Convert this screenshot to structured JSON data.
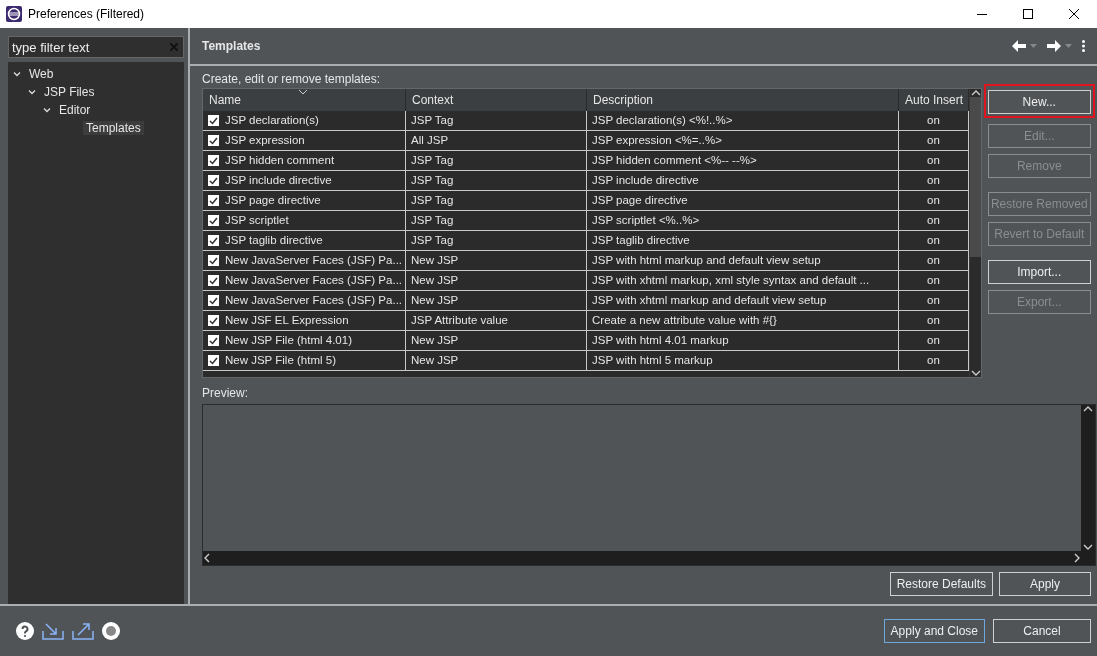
{
  "window": {
    "title": "Preferences (Filtered)"
  },
  "filter": {
    "placeholder": "type filter text"
  },
  "tree": [
    {
      "label": "Web",
      "expanded": true,
      "selected": false,
      "children": [
        {
          "label": "JSP Files",
          "expanded": true,
          "selected": false,
          "children": [
            {
              "label": "Editor",
              "expanded": true,
              "selected": false,
              "children": [
                {
                  "label": "Templates",
                  "selected": true
                }
              ]
            }
          ]
        }
      ]
    }
  ],
  "page": {
    "title": "Templates",
    "intro": "Create, edit or remove templates:"
  },
  "table": {
    "columns": [
      "Name",
      "Context",
      "Description",
      "Auto Insert"
    ],
    "rows": [
      {
        "checked": true,
        "name": "JSP declaration(s)",
        "context": "JSP Tag",
        "description": "JSP declaration(s) <%!..%>",
        "auto_insert": "on"
      },
      {
        "checked": true,
        "name": "JSP expression",
        "context": "All JSP",
        "description": "JSP expression <%=..%>",
        "auto_insert": "on"
      },
      {
        "checked": true,
        "name": "JSP hidden comment",
        "context": "JSP Tag",
        "description": "JSP hidden comment <%-- --%>",
        "auto_insert": "on"
      },
      {
        "checked": true,
        "name": "JSP include directive",
        "context": "JSP Tag",
        "description": "JSP include directive",
        "auto_insert": "on"
      },
      {
        "checked": true,
        "name": "JSP page directive",
        "context": "JSP Tag",
        "description": "JSP page directive",
        "auto_insert": "on"
      },
      {
        "checked": true,
        "name": "JSP scriptlet",
        "context": "JSP Tag",
        "description": "JSP scriptlet <%..%>",
        "auto_insert": "on"
      },
      {
        "checked": true,
        "name": "JSP taglib directive",
        "context": "JSP Tag",
        "description": "JSP taglib directive",
        "auto_insert": "on"
      },
      {
        "checked": true,
        "name": "New JavaServer Faces (JSF) Pa...",
        "context": "New JSP",
        "description": "JSP with html markup and default view setup",
        "auto_insert": "on"
      },
      {
        "checked": true,
        "name": "New JavaServer Faces (JSF) Pa...",
        "context": "New JSP",
        "description": "JSP with xhtml markup, xml style syntax and default ...",
        "auto_insert": "on"
      },
      {
        "checked": true,
        "name": "New JavaServer Faces (JSF) Pa...",
        "context": "New JSP",
        "description": "JSP with xhtml markup and default view setup",
        "auto_insert": "on"
      },
      {
        "checked": true,
        "name": "New JSF EL Expression",
        "context": "JSP Attribute value",
        "description": "Create a new attribute value with #{}",
        "auto_insert": "on"
      },
      {
        "checked": true,
        "name": "New JSP File (html 4.01)",
        "context": "New JSP",
        "description": "JSP with html 4.01 markup",
        "auto_insert": "on"
      },
      {
        "checked": true,
        "name": "New JSP File (html 5)",
        "context": "New JSP",
        "description": "JSP with html 5 markup",
        "auto_insert": "on"
      }
    ]
  },
  "side_button_groups": [
    [
      {
        "label": "New...",
        "disabled": false,
        "highlighted": true
      },
      {
        "label": "Edit...",
        "disabled": true,
        "highlighted": false
      },
      {
        "label": "Remove",
        "disabled": true,
        "highlighted": false
      }
    ],
    [
      {
        "label": "Restore Removed",
        "disabled": true,
        "highlighted": false
      },
      {
        "label": "Revert to Default",
        "disabled": true,
        "highlighted": false
      }
    ],
    [
      {
        "label": "Import...",
        "disabled": false,
        "highlighted": false
      },
      {
        "label": "Export...",
        "disabled": true,
        "highlighted": false
      }
    ]
  ],
  "preview": {
    "label": "Preview:"
  },
  "page_buttons": [
    "Restore Defaults",
    "Apply"
  ],
  "dialog_buttons": [
    {
      "label": "Apply and Close",
      "default": true
    },
    {
      "label": "Cancel",
      "default": false
    }
  ]
}
